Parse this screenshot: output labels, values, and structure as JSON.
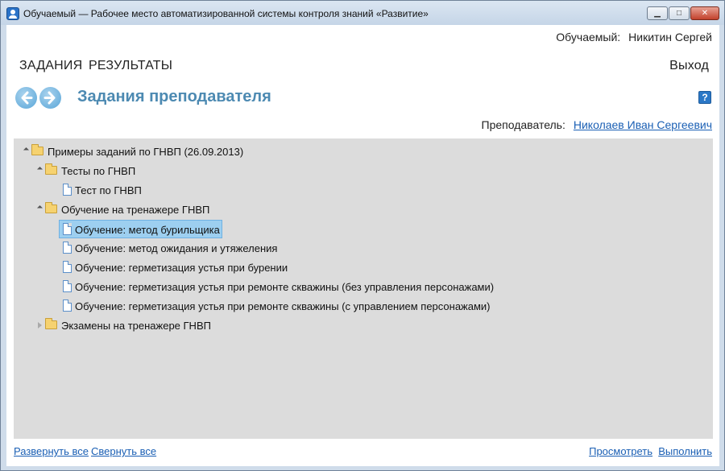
{
  "window": {
    "title": "Обучаемый — Рабочее место автоматизированной системы контроля знаний «Развитие»",
    "min_glyph": "▁",
    "max_glyph": "□",
    "close_glyph": "✕"
  },
  "user": {
    "label": "Обучаемый:",
    "name": "Никитин Сергей"
  },
  "nav": {
    "tasks": "ЗАДАНИЯ",
    "results": "РЕЗУЛЬТАТЫ",
    "exit": "Выход"
  },
  "page": {
    "title": "Задания преподавателя",
    "help": "?"
  },
  "teacher": {
    "label": "Преподаватель:",
    "name": "Николаев Иван Сергеевич"
  },
  "tree": {
    "items": [
      {
        "label": "Примеры заданий по ГНВП (26.09.2013)",
        "type": "folder",
        "expanded": true
      },
      {
        "label": "Тесты по ГНВП",
        "type": "folder",
        "expanded": true
      },
      {
        "label": "Тест по ГНВП",
        "type": "document"
      },
      {
        "label": "Обучение на тренажере ГНВП",
        "type": "folder",
        "expanded": true
      },
      {
        "label": "Обучение: метод бурильщика",
        "type": "document",
        "selected": true
      },
      {
        "label": "Обучение: метод ожидания и утяжеления",
        "type": "document"
      },
      {
        "label": "Обучение: герметизация устья при бурении",
        "type": "document"
      },
      {
        "label": "Обучение: герметизация устья при ремонте скважины (без управления персонажами)",
        "type": "document"
      },
      {
        "label": "Обучение: герметизация устья при ремонте скважины (с управлением персонажами)",
        "type": "document"
      },
      {
        "label": "Экзамены на тренажере ГНВП",
        "type": "folder",
        "expanded": false
      }
    ]
  },
  "footer": {
    "expand_all": "Развернуть все",
    "collapse_all": "Свернуть все",
    "view": "Просмотреть",
    "run": "Выполнить"
  },
  "colors": {
    "title_accent": "#4d8ab2",
    "link": "#1a5fb4",
    "tree_background": "#dcdcdc",
    "selection": "#9dcff0"
  }
}
